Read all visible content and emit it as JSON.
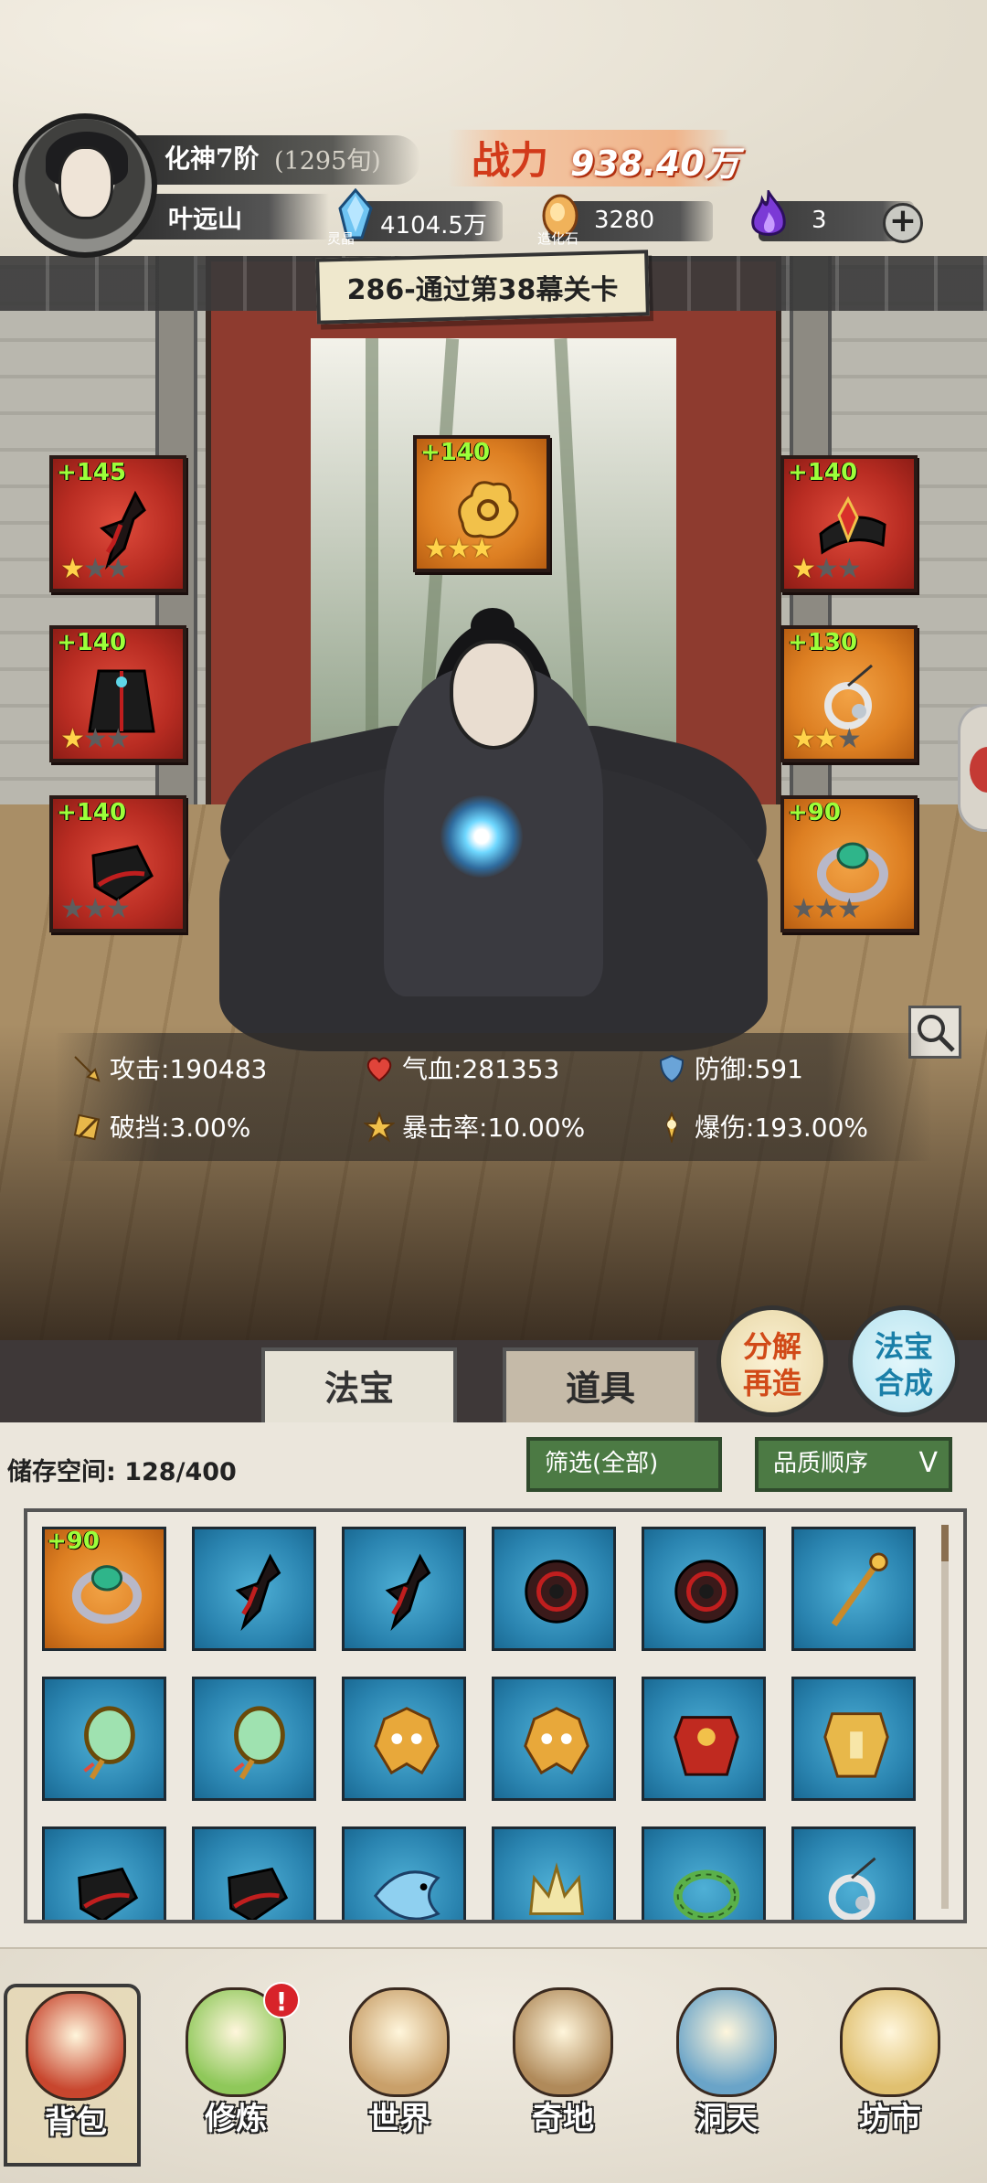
{
  "header": {
    "rank": "化神7阶",
    "rank_sub": "(1295旬)",
    "player_name": "叶远山",
    "power_label": "战力",
    "power_value": "938.40万",
    "resources": [
      {
        "icon": "spirit-crystal-icon",
        "caption": "灵晶",
        "value": "4104.5万"
      },
      {
        "icon": "creation-stone-icon",
        "caption": "造化石",
        "value": "3280"
      },
      {
        "icon": "purple-flame-icon",
        "caption": "",
        "value": "3"
      }
    ],
    "add_button": "+"
  },
  "stage": {
    "text": "286-通过第38幕关卡"
  },
  "equipment": [
    {
      "slot": "left-1",
      "level": "+145",
      "stars": 1,
      "color": "red",
      "icon": "red-claw-icon"
    },
    {
      "slot": "left-2",
      "level": "+140",
      "stars": 1,
      "color": "red",
      "icon": "dark-robe-icon"
    },
    {
      "slot": "left-3",
      "level": "+140",
      "stars": 0,
      "color": "red",
      "icon": "black-boots-icon"
    },
    {
      "slot": "top",
      "level": "+140",
      "stars": 3,
      "color": "orange",
      "icon": "golden-cloud-icon"
    },
    {
      "slot": "right-1",
      "level": "+140",
      "stars": 1,
      "color": "red",
      "icon": "crimson-crown-icon"
    },
    {
      "slot": "right-2",
      "level": "+130",
      "stars": 2,
      "color": "orange",
      "icon": "silver-pendant-icon"
    },
    {
      "slot": "right-3",
      "level": "+90",
      "stars": 0,
      "color": "orange",
      "icon": "jade-ring-icon"
    }
  ],
  "stats": [
    {
      "label": "攻击:",
      "value": "190483",
      "icon": "sword-icon"
    },
    {
      "label": "气血:",
      "value": "281353",
      "icon": "heart-icon"
    },
    {
      "label": "防御:",
      "value": "591",
      "icon": "shield-icon"
    },
    {
      "label": "破挡:",
      "value": "3.00%",
      "icon": "break-icon"
    },
    {
      "label": "暴击率:",
      "value": "10.00%",
      "icon": "crit-icon"
    },
    {
      "label": "爆伤:",
      "value": "193.00%",
      "icon": "crit-damage-icon"
    }
  ],
  "tabs": {
    "treasure": "法宝",
    "items": "道具"
  },
  "actions": {
    "decompose": [
      "分解",
      "再造"
    ],
    "fuse": [
      "法宝",
      "合成"
    ]
  },
  "inventory": {
    "storage_label": "储存空间:",
    "storage_value": "128/400",
    "filter_label": "筛选(全部)",
    "sort_label": "品质顺序",
    "sort_chevron": "V",
    "cells": [
      {
        "level": "+90",
        "color": "orange",
        "icon": "jade-ring-icon"
      },
      {
        "level": "",
        "color": "blue",
        "icon": "red-claw-icon"
      },
      {
        "level": "",
        "color": "blue",
        "icon": "red-claw-icon"
      },
      {
        "level": "",
        "color": "blue",
        "icon": "spiked-disc-icon"
      },
      {
        "level": "",
        "color": "blue",
        "icon": "spiked-disc-icon"
      },
      {
        "level": "",
        "color": "blue",
        "icon": "golden-staff-icon"
      },
      {
        "level": "",
        "color": "blue",
        "icon": "jade-mirror-icon"
      },
      {
        "level": "",
        "color": "blue",
        "icon": "jade-mirror-icon"
      },
      {
        "level": "",
        "color": "blue",
        "icon": "golden-mask-icon"
      },
      {
        "level": "",
        "color": "blue",
        "icon": "golden-mask-icon"
      },
      {
        "level": "",
        "color": "blue",
        "icon": "crimson-armor-icon"
      },
      {
        "level": "",
        "color": "blue",
        "icon": "golden-armor-icon"
      },
      {
        "level": "",
        "color": "blue",
        "icon": "black-boots-icon"
      },
      {
        "level": "",
        "color": "blue",
        "icon": "black-boots-icon"
      },
      {
        "level": "",
        "color": "blue",
        "icon": "blue-fish-icon"
      },
      {
        "level": "",
        "color": "blue",
        "icon": "gold-crown-icon"
      },
      {
        "level": "",
        "color": "blue",
        "icon": "green-wreath-icon"
      },
      {
        "level": "",
        "color": "blue",
        "icon": "silver-pendant-icon"
      }
    ]
  },
  "nav": [
    {
      "label": "背包",
      "icon": "backpack-icon"
    },
    {
      "label": "修炼",
      "icon": "lotus-icon"
    },
    {
      "label": "世界",
      "icon": "scroll-map-icon"
    },
    {
      "label": "奇地",
      "icon": "floating-island-icon"
    },
    {
      "label": "洞天",
      "icon": "portal-icon"
    },
    {
      "label": "坊市",
      "icon": "market-stall-icon"
    }
  ],
  "nav_badge": "!",
  "colors": {
    "accent_red": "#d23a1a",
    "level_green": "#9cff3a",
    "star_gold": "#ffd34a",
    "pill_green": "#4c7a44"
  }
}
